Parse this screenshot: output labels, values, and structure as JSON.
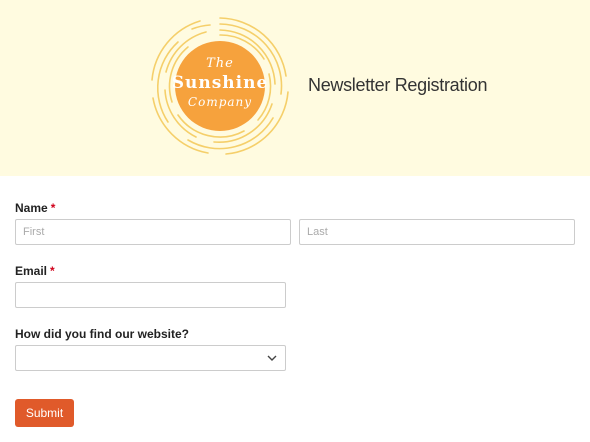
{
  "header": {
    "logo": {
      "line1": "The",
      "line2": "Sunshine",
      "line3": "Company"
    },
    "title": "Newsletter Registration",
    "background_color": "#fffbe0",
    "logo_color": "#f6a23d"
  },
  "form": {
    "name": {
      "label": "Name",
      "required_mark": "*",
      "first_placeholder": "First",
      "last_placeholder": "Last"
    },
    "email": {
      "label": "Email",
      "required_mark": "*",
      "value": ""
    },
    "source": {
      "label": "How did you find our website?",
      "selected": ""
    },
    "submit_label": "Submit",
    "submit_color": "#e05a2a"
  }
}
